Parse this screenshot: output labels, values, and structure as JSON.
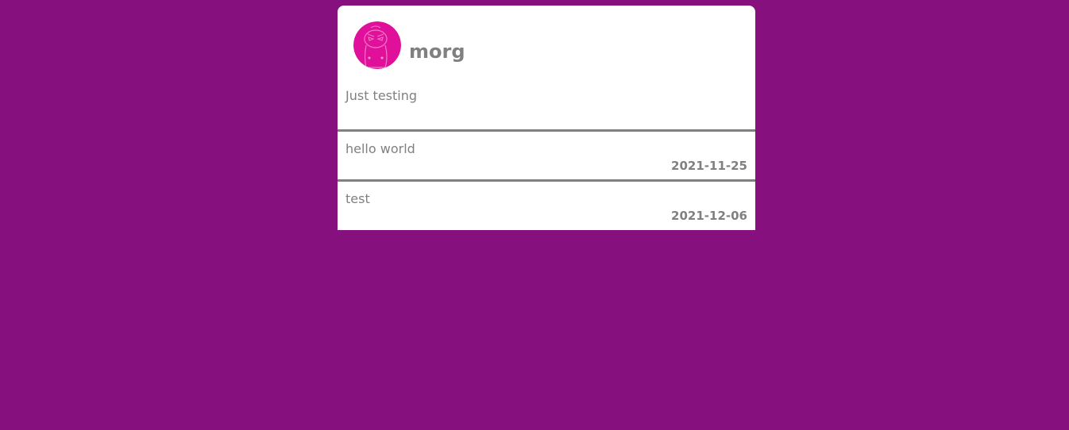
{
  "profile": {
    "username": "morg",
    "bio": "Just testing",
    "avatar_icon": "cartoon-face-icon"
  },
  "posts": [
    {
      "text": "hello world",
      "date": "2021-11-25"
    },
    {
      "text": "test",
      "date": "2021-12-06"
    }
  ],
  "colors": {
    "background": "#87107f",
    "card": "#ffffff",
    "text": "#808080",
    "avatar": "#e0109a"
  }
}
